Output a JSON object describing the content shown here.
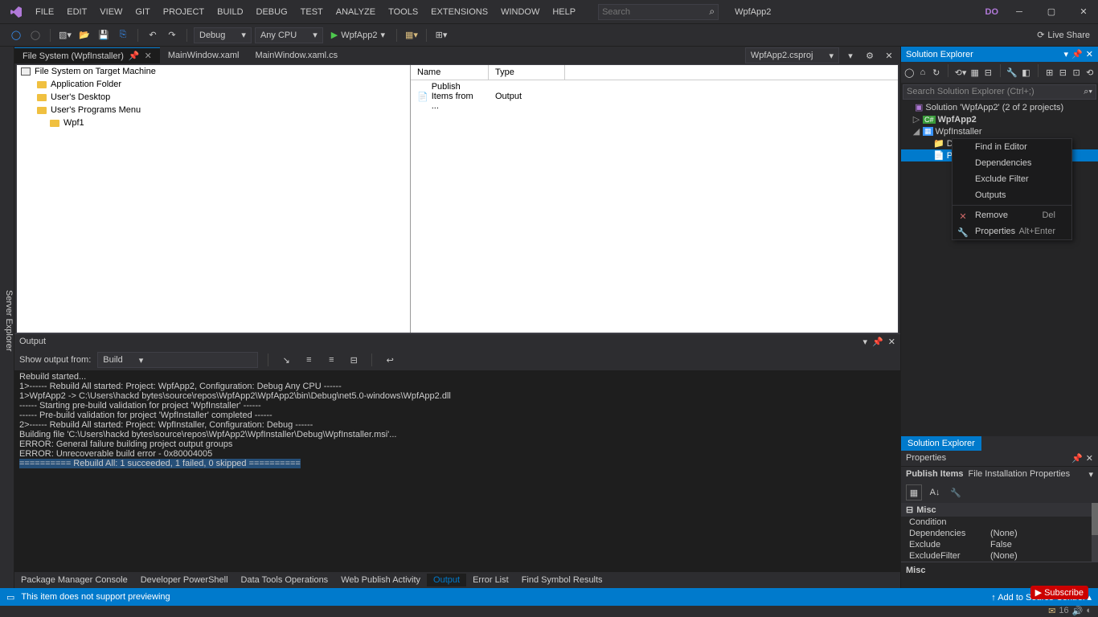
{
  "menu": [
    "FILE",
    "EDIT",
    "VIEW",
    "GIT",
    "PROJECT",
    "BUILD",
    "DEBUG",
    "TEST",
    "ANALYZE",
    "TOOLS",
    "EXTENSIONS",
    "WINDOW",
    "HELP"
  ],
  "search": {
    "placeholder": "Search"
  },
  "app_title": "WpfApp2",
  "user_badge": "DO",
  "live_share": "Live Share",
  "config": "Debug",
  "platform": "Any CPU",
  "start_target": "WpfApp2",
  "tabs": [
    {
      "label": "File System (WpfInstaller)",
      "active": true
    },
    {
      "label": "MainWindow.xaml",
      "active": false
    },
    {
      "label": "MainWindow.xaml.cs",
      "active": false
    }
  ],
  "tabs_combo": "WpfApp2.csproj",
  "left_rail": "Server Explorer",
  "fs_tree": {
    "root": "File System on Target Machine",
    "children": [
      {
        "label": "Application Folder"
      },
      {
        "label": "User's Desktop"
      },
      {
        "label": "User's Programs Menu",
        "children": [
          {
            "label": "Wpf1"
          }
        ]
      }
    ]
  },
  "list": {
    "columns": [
      "Name",
      "Type"
    ],
    "rows": [
      {
        "name": "Publish Items from ...",
        "type": "Output"
      }
    ]
  },
  "solution_explorer": {
    "title": "Solution Explorer",
    "search_placeholder": "Search Solution Explorer (Ctrl+;)",
    "root": "Solution 'WpfApp2' (2 of 2 projects)",
    "nodes": [
      {
        "label": "WpfApp2",
        "bold": true
      },
      {
        "label": "WpfInstaller",
        "expanded": true,
        "children": [
          {
            "label": "Detected Dependencies"
          },
          {
            "label": "Publ",
            "selected": true
          }
        ]
      }
    ],
    "bottom_tabs": [
      "Solution Explorer"
    ]
  },
  "properties": {
    "title": "Properties",
    "object_name": "Publish Items",
    "object_type": "File Installation Properties",
    "category": "Misc",
    "rows": [
      {
        "key": "Condition",
        "val": ""
      },
      {
        "key": "Dependencies",
        "val": "(None)"
      },
      {
        "key": "Exclude",
        "val": "False"
      },
      {
        "key": "ExcludeFilter",
        "val": "(None)"
      }
    ],
    "desc_title": "Misc"
  },
  "context_menu": {
    "items": [
      {
        "label": "Find in Editor"
      },
      {
        "label": "Dependencies"
      },
      {
        "label": "Exclude Filter"
      },
      {
        "label": "Outputs"
      },
      {
        "sep": true
      },
      {
        "label": "Remove",
        "shortcut": "Del",
        "icon": "x"
      },
      {
        "label": "Properties",
        "shortcut": "Alt+Enter",
        "icon": "wrench"
      }
    ]
  },
  "output": {
    "title": "Output",
    "show_from_label": "Show output from:",
    "show_from": "Build",
    "text": "Rebuild started...\n1>------ Rebuild All started: Project: WpfApp2, Configuration: Debug Any CPU ------\n1>WpfApp2 -> C:\\Users\\hackd bytes\\source\\repos\\WpfApp2\\WpfApp2\\bin\\Debug\\net5.0-windows\\WpfApp2.dll\n------ Starting pre-build validation for project 'WpfInstaller' ------\n------ Pre-build validation for project 'WpfInstaller' completed ------\n2>------ Rebuild All started: Project: WpfInstaller, Configuration: Debug ------\nBuilding file 'C:\\Users\\hackd bytes\\source\\repos\\WpfApp2\\WpfInstaller\\Debug\\WpfInstaller.msi'...\nERROR: General failure building project output groups\nERROR: Unrecoverable build error - 0x80004005\n========== Rebuild All: 1 succeeded, 1 failed, 0 skipped =========="
  },
  "bottom_tabs": [
    "Package Manager Console",
    "Developer PowerShell",
    "Data Tools Operations",
    "Web Publish Activity",
    "Output",
    "Error List",
    "Find Symbol Results"
  ],
  "bottom_active": "Output",
  "status": {
    "msg": "This item does not support previewing",
    "add_source": "Add to Source Control"
  },
  "sub_badge": "Subscribe",
  "taskbar_icons": "16"
}
